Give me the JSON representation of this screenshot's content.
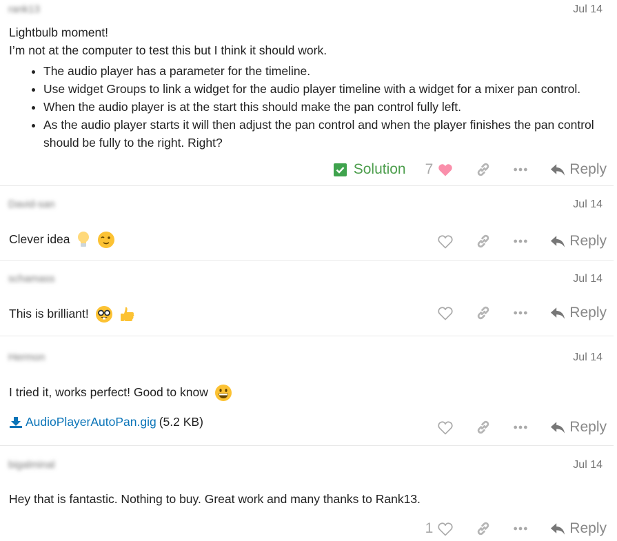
{
  "posts": [
    {
      "username": "rank13",
      "date": "Jul 14",
      "lines": [
        "Lightbulb moment!",
        "I’m not at the computer to test this but I think it should work."
      ],
      "bullets": [
        "The audio player has a parameter for the timeline.",
        "Use widget Groups to link a widget for the audio player timeline with a widget for a mixer pan control.",
        "When the audio player is at the start this should make the pan control fully left.",
        "As the audio player starts it will then adjust the pan control and when the player finishes the pan control should be fully to the right. Right?"
      ],
      "solution_label": "Solution",
      "like_count": "7",
      "liked": true,
      "reply_label": "Reply"
    },
    {
      "username": "David-san",
      "date": "Jul 14",
      "text": "Clever idea",
      "emojis": [
        "light-bulb",
        "winking-face"
      ],
      "reply_label": "Reply"
    },
    {
      "username": "schamass",
      "date": "Jul 14",
      "text": "This is brilliant!",
      "emojis": [
        "nerd-face",
        "thumbs-up"
      ],
      "reply_label": "Reply"
    },
    {
      "username": "Hermon",
      "date": "Jul 14",
      "text": "I tried it, works perfect! Good to know",
      "emojis": [
        "grinning-face"
      ],
      "attachment": {
        "name": "AudioPlayerAutoPan.gig",
        "size": "(5.2 KB)"
      },
      "reply_label": "Reply"
    },
    {
      "username": "bigalminal",
      "date": "Jul 14",
      "text": "Hey that is fantastic. Nothing to buy. Great work and many thanks to Rank13.",
      "like_count": "1",
      "reply_label": "Reply"
    }
  ],
  "colors": {
    "solution": "#3fa34d",
    "liked_heart": "#fa8fab",
    "link": "#0a74b8"
  }
}
